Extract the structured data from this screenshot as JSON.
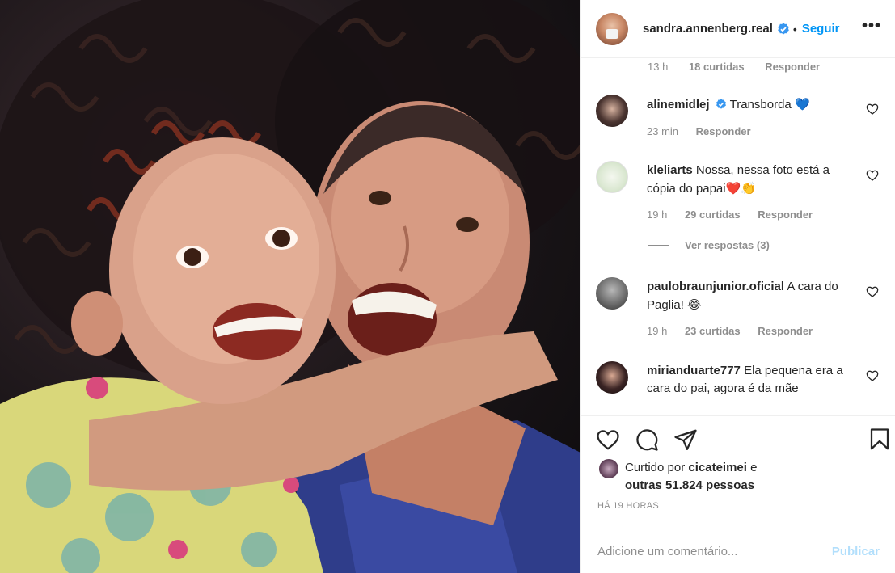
{
  "post": {
    "author": "sandra.annenberg.real",
    "follow_label": "Seguir",
    "dot": "•",
    "more_label": "•••"
  },
  "cut_row": {
    "time": "13 h",
    "likes": "18 curtidas",
    "reply": "Responder"
  },
  "comments": [
    {
      "user": "alinemidlej",
      "text": "Transborda",
      "emoji": "💙",
      "time": "23 min",
      "likes": "",
      "reply": "Responder",
      "verified": true
    },
    {
      "user": "kleliarts",
      "text": "Nossa, nessa foto está a cópia do papai",
      "emoji": "❤️👏",
      "time": "19 h",
      "likes": "29 curtidas",
      "reply": "Responder"
    },
    {
      "user": "paulobraunjunior.oficial",
      "text": "A cara do Paglia!",
      "emoji": "😂",
      "time": "19 h",
      "likes": "23 curtidas",
      "reply": "Responder"
    },
    {
      "user": "mirianduarte777",
      "text": "Ela pequena era a cara do pai, agora é da mãe"
    }
  ],
  "view_replies": "Ver respostas (3)",
  "likes": {
    "prefix": "Curtido por",
    "user": "cicateimei",
    "conj": "e",
    "others": "outras 51.824 pessoas"
  },
  "timestamp": "HÁ 19 HORAS",
  "add_comment": {
    "placeholder": "Adicione um comentário...",
    "publish": "Publicar"
  },
  "colors": {
    "accent": "#0095f6",
    "publish_disabled": "#b2dffc",
    "verified": "#3897f0",
    "heart": "#ed4956"
  },
  "icons": [
    "heart-icon",
    "comment-icon",
    "share-icon",
    "bookmark-icon",
    "verified-icon",
    "more-icon"
  ]
}
